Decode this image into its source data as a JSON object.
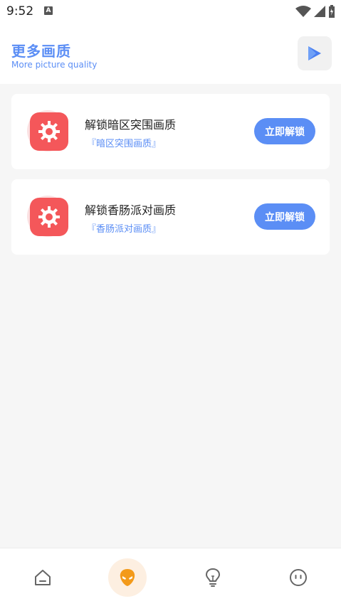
{
  "status": {
    "time": "9:52",
    "notification_icon": "A"
  },
  "header": {
    "title": "更多画质",
    "subtitle": "More picture quality"
  },
  "cards": [
    {
      "title": "解锁暗区突围画质",
      "subtitle": "『暗区突围画质』",
      "button": "立即解锁",
      "icon": "gear-icon"
    },
    {
      "title": "解锁香肠派对画质",
      "subtitle": "『香肠派对画质』",
      "button": "立即解锁",
      "icon": "gear-icon"
    }
  ],
  "nav": {
    "items": [
      "home-icon",
      "alien-icon",
      "lightbulb-icon",
      "face-icon"
    ],
    "active_index": 1
  },
  "colors": {
    "accent": "#5b8ef5",
    "icon_red": "#f4575a",
    "active_orange": "#f39a1a"
  }
}
